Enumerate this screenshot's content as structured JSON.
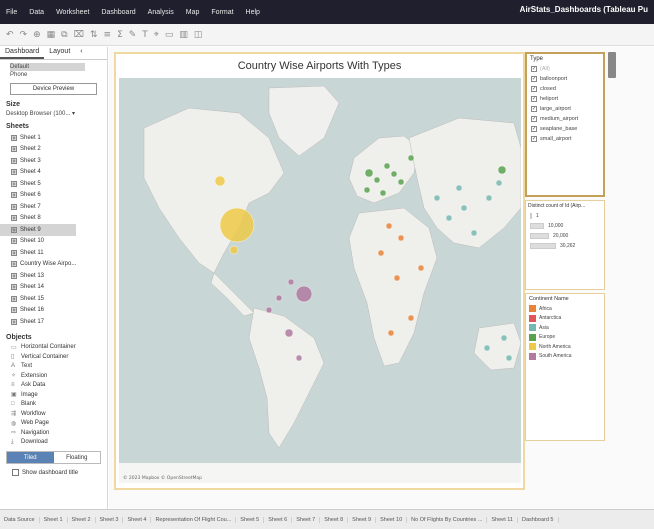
{
  "menu": {
    "items": [
      "File",
      "Data",
      "Worksheet",
      "Dashboard",
      "Analysis",
      "Map",
      "Format",
      "Help"
    ]
  },
  "app_title": "AirStats_Dashboards (Tableau Pu",
  "left": {
    "tabs": [
      "Dashboard",
      "Layout"
    ],
    "device": {
      "default": "Default",
      "phone": "Phone",
      "preview_button": "Device Preview"
    },
    "size_label": "Size",
    "size_value": "Desktop Browser (100...",
    "sheets_label": "Sheets",
    "sheets": [
      "Sheet 1",
      "Sheet 2",
      "Sheet 3",
      "Sheet 4",
      "Sheet 5",
      "Sheet 6",
      "Sheet 7",
      "Sheet 8",
      "Sheet 9",
      "Sheet 10",
      "Sheet 11",
      "Country Wise Airpo...",
      "Sheet 13",
      "Sheet 14",
      "Sheet 15",
      "Sheet 16",
      "Sheet 17"
    ],
    "selected_sheet": "Sheet 9",
    "objects_label": "Objects",
    "objects": [
      {
        "label": "Horizontal Container",
        "icon": "horizontal-container-icon",
        "glyph": "▭"
      },
      {
        "label": "Vertical Container",
        "icon": "vertical-container-icon",
        "glyph": "▯"
      },
      {
        "label": "Text",
        "icon": "text-icon",
        "glyph": "A"
      },
      {
        "label": "Extension",
        "icon": "extension-icon",
        "glyph": "✧"
      },
      {
        "label": "Ask Data",
        "icon": "ask-data-icon",
        "glyph": "≡"
      },
      {
        "label": "Image",
        "icon": "image-icon",
        "glyph": "▣"
      },
      {
        "label": "Blank",
        "icon": "blank-icon",
        "glyph": "□"
      },
      {
        "label": "Workflow",
        "icon": "workflow-icon",
        "glyph": "⇶"
      },
      {
        "label": "Web Page",
        "icon": "web-page-icon",
        "glyph": "◍"
      },
      {
        "label": "Navigation",
        "icon": "navigation-icon",
        "glyph": "⇨"
      },
      {
        "label": "Download",
        "icon": "download-icon",
        "glyph": "⤓"
      }
    ],
    "tiled": "Tiled",
    "floating": "Floating",
    "show_title": "Show dashboard title"
  },
  "dashboard": {
    "title": "Country Wise Airports With Types",
    "attribution": "© 2023 Mapbox © OpenStreetMap"
  },
  "type_legend": {
    "title": "Type",
    "items": [
      {
        "label": "(All)",
        "checked": true,
        "dim": true
      },
      {
        "label": "balloonport",
        "checked": true
      },
      {
        "label": "closed",
        "checked": true
      },
      {
        "label": "heliport",
        "checked": true
      },
      {
        "label": "large_airport",
        "checked": true
      },
      {
        "label": "medium_airport",
        "checked": true
      },
      {
        "label": "seaplane_base",
        "checked": true
      },
      {
        "label": "small_airport",
        "checked": true
      }
    ]
  },
  "size_legend": {
    "title": "Distinct count of Id (Airp...",
    "items": [
      "1",
      "10,000",
      "20,000",
      "30,262"
    ]
  },
  "continent_legend": {
    "title": "Continent Name",
    "items": [
      {
        "label": "Africa",
        "color": "#e8833a"
      },
      {
        "label": "Antarctica",
        "color": "#e15759"
      },
      {
        "label": "Asia",
        "color": "#76b7b2"
      },
      {
        "label": "Europe",
        "color": "#59a14f"
      },
      {
        "label": "North America",
        "color": "#edc948"
      },
      {
        "label": "South America",
        "color": "#b07aa1"
      }
    ]
  },
  "bottom_tabs": [
    "Data Source",
    "Sheet 1",
    "Sheet 2",
    "Sheet 3",
    "Sheet 4",
    "Representation Of Flight Cou...",
    "Sheet 5",
    "Sheet 6",
    "Sheet 7",
    "Sheet 8",
    "Sheet 9",
    "Sheet 10",
    "No Of Flights By Countries ...",
    "Sheet 11",
    "Dashboard 5"
  ]
}
